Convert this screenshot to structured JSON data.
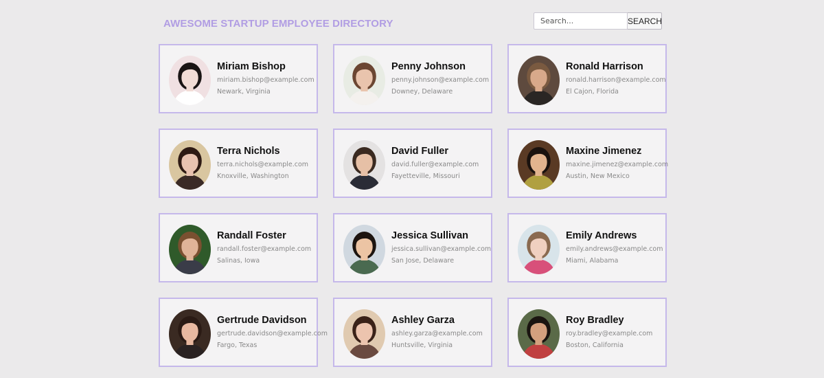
{
  "header": {
    "title": "AWESOME STARTUP EMPLOYEE DIRECTORY"
  },
  "search": {
    "placeholder": "Search...",
    "button_label": "SEARCH"
  },
  "employees": [
    {
      "name": "Miriam Bishop",
      "email": "miriam.bishop@example.com",
      "location": "Newark, Virginia",
      "bg": "#f0e0e2",
      "hair": "#1a1414",
      "skin": "#f2dcd6",
      "shirt": "#ffffff"
    },
    {
      "name": "Penny Johnson",
      "email": "penny.johnson@example.com",
      "location": "Downey, Delaware",
      "bg": "#e8ece4",
      "hair": "#6b4632",
      "skin": "#e9c4ad",
      "shirt": "#f4f1ee"
    },
    {
      "name": "Ronald Harrison",
      "email": "ronald.harrison@example.com",
      "location": "El Cajon, Florida",
      "bg": "#5e4a3e",
      "hair": "#7a5a40",
      "skin": "#d8a98a",
      "shirt": "#2a2624"
    },
    {
      "name": "Terra Nichols",
      "email": "terra.nichols@example.com",
      "location": "Knoxville, Washington",
      "bg": "#d9c6a0",
      "hair": "#2e1a14",
      "skin": "#e8c2b0",
      "shirt": "#3a2a26"
    },
    {
      "name": "David Fuller",
      "email": "david.fuller@example.com",
      "location": "Fayetteville, Missouri",
      "bg": "#e4e2e2",
      "hair": "#3a2a20",
      "skin": "#e6c0a6",
      "shirt": "#2a2c36"
    },
    {
      "name": "Maxine Jimenez",
      "email": "maxine.jimenez@example.com",
      "location": "Austin, New Mexico",
      "bg": "#5a3a24",
      "hair": "#1a120e",
      "skin": "#e2b48e",
      "shirt": "#b0a040"
    },
    {
      "name": "Randall Foster",
      "email": "randall.foster@example.com",
      "location": "Salinas, Iowa",
      "bg": "#2f5a2a",
      "hair": "#7a5030",
      "skin": "#e0b498",
      "shirt": "#3a3c48"
    },
    {
      "name": "Jessica Sullivan",
      "email": "jessica.sullivan@example.com",
      "location": "San Jose, Delaware",
      "bg": "#d0d8e0",
      "hair": "#1c1410",
      "skin": "#ecc4a4",
      "shirt": "#4a6a50"
    },
    {
      "name": "Emily Andrews",
      "email": "emily.andrews@example.com",
      "location": "Miami, Alabama",
      "bg": "#d8e4ea",
      "hair": "#8a6a50",
      "skin": "#f0d0c0",
      "shirt": "#d8507a"
    },
    {
      "name": "Gertrude Davidson",
      "email": "gertrude.davidson@example.com",
      "location": "Fargo, Texas",
      "bg": "#3a2a22",
      "hair": "#2a1a14",
      "skin": "#e8b8a0",
      "shirt": "#2a2222"
    },
    {
      "name": "Ashley Garza",
      "email": "ashley.garza@example.com",
      "location": "Huntsville, Virginia",
      "bg": "#e0cab0",
      "hair": "#3a2218",
      "skin": "#ecc4ae",
      "shirt": "#6a4a40"
    },
    {
      "name": "Roy Bradley",
      "email": "roy.bradley@example.com",
      "location": "Boston, California",
      "bg": "#5a6a48",
      "hair": "#1a1410",
      "skin": "#d4a07e",
      "shirt": "#c04040"
    }
  ]
}
